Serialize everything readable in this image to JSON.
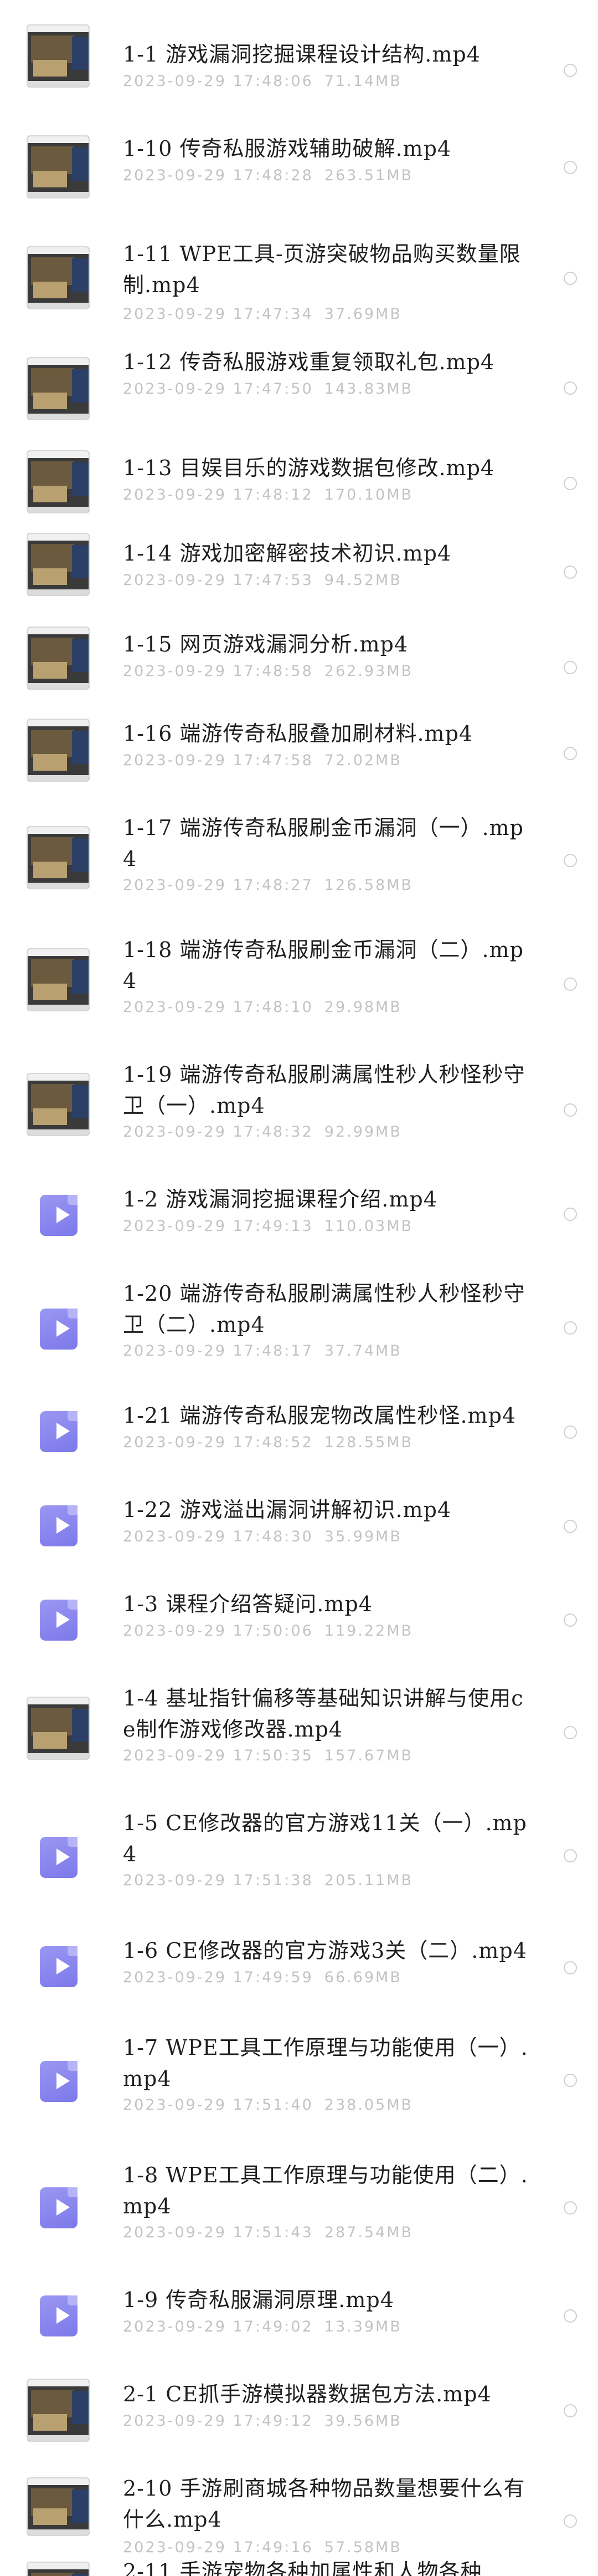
{
  "files": [
    {
      "name": "1-1 游戏漏洞挖掘课程设计结构.mp4",
      "date": "2023-09-29 17:48:06",
      "size": "71.14MB",
      "thumb": "video-thumbnail"
    },
    {
      "name": "1-10 传奇私服游戏辅助破解.mp4",
      "date": "2023-09-29 17:48:28",
      "size": "263.51MB",
      "thumb": "video-thumbnail"
    },
    {
      "name": "1-11 WPE工具-页游突破物品购买数量限制.mp4",
      "date": "2023-09-29 17:47:34",
      "size": "37.69MB",
      "thumb": "video-thumbnail"
    },
    {
      "name": "1-12 传奇私服游戏重复领取礼包.mp4",
      "date": "2023-09-29 17:47:50",
      "size": "143.83MB",
      "thumb": "video-thumbnail"
    },
    {
      "name": "1-13 目娱目乐的游戏数据包修改.mp4",
      "date": "2023-09-29 17:48:12",
      "size": "170.10MB",
      "thumb": "video-thumbnail"
    },
    {
      "name": "1-14 游戏加密解密技术初识.mp4",
      "date": "2023-09-29 17:47:53",
      "size": "94.52MB",
      "thumb": "video-thumbnail"
    },
    {
      "name": "1-15 网页游戏漏洞分析.mp4",
      "date": "2023-09-29 17:48:58",
      "size": "262.93MB",
      "thumb": "video-thumbnail"
    },
    {
      "name": "1-16 端游传奇私服叠加刷材料.mp4",
      "date": "2023-09-29 17:47:58",
      "size": "72.02MB",
      "thumb": "video-thumbnail"
    },
    {
      "name": "1-17 端游传奇私服刷金币漏洞（一）.mp4",
      "date": "2023-09-29 17:48:27",
      "size": "126.58MB",
      "thumb": "video-thumbnail"
    },
    {
      "name": "1-18 端游传奇私服刷金币漏洞（二）.mp4",
      "date": "2023-09-29 17:48:10",
      "size": "29.98MB",
      "thumb": "video-thumbnail"
    },
    {
      "name": "1-19 端游传奇私服刷满属性秒人秒怪秒守卫（一）.mp4",
      "date": "2023-09-29 17:48:32",
      "size": "92.99MB",
      "thumb": "video-thumbnail"
    },
    {
      "name": "1-2 游戏漏洞挖掘课程介绍.mp4",
      "date": "2023-09-29 17:49:13",
      "size": "110.03MB",
      "thumb": "video-file-icon"
    },
    {
      "name": "1-20 端游传奇私服刷满属性秒人秒怪秒守卫（二）.mp4",
      "date": "2023-09-29 17:48:17",
      "size": "37.74MB",
      "thumb": "video-file-icon"
    },
    {
      "name": "1-21 端游传奇私服宠物改属性秒怪.mp4",
      "date": "2023-09-29 17:48:52",
      "size": "128.55MB",
      "thumb": "video-file-icon"
    },
    {
      "name": "1-22 游戏溢出漏洞讲解初识.mp4",
      "date": "2023-09-29 17:48:30",
      "size": "35.99MB",
      "thumb": "video-file-icon"
    },
    {
      "name": "1-3 课程介绍答疑问.mp4",
      "date": "2023-09-29 17:50:06",
      "size": "119.22MB",
      "thumb": "video-file-icon"
    },
    {
      "name": "1-4 基址指针偏移等基础知识讲解与使用ce制作游戏修改器.mp4",
      "date": "2023-09-29 17:50:35",
      "size": "157.67MB",
      "thumb": "video-thumbnail"
    },
    {
      "name": "1-5 CE修改器的官方游戏11关（一）.mp4",
      "date": "2023-09-29 17:51:38",
      "size": "205.11MB",
      "thumb": "video-file-icon"
    },
    {
      "name": "1-6 CE修改器的官方游戏3关（二）.mp4",
      "date": "2023-09-29 17:49:59",
      "size": "66.69MB",
      "thumb": "video-file-icon"
    },
    {
      "name": "1-7 WPE工具工作原理与功能使用（一）.mp4",
      "date": "2023-09-29 17:51:40",
      "size": "238.05MB",
      "thumb": "video-file-icon"
    },
    {
      "name": "1-8 WPE工具工作原理与功能使用（二）.mp4",
      "date": "2023-09-29 17:51:43",
      "size": "287.54MB",
      "thumb": "video-file-icon"
    },
    {
      "name": "1-9 传奇私服漏洞原理.mp4",
      "date": "2023-09-29 17:49:02",
      "size": "13.39MB",
      "thumb": "video-file-icon"
    },
    {
      "name": "2-1 CE抓手游模拟器数据包方法.mp4",
      "date": "2023-09-29 17:49:12",
      "size": "39.56MB",
      "thumb": "video-thumbnail"
    },
    {
      "name": "2-10 手游刷商城各种物品数量想要什么有什么.mp4",
      "date": "2023-09-29 17:49:16",
      "size": "57.58MB",
      "thumb": "video-thumbnail"
    },
    {
      "name": "2-11 手游宠物各种加属性和人物各种",
      "date": "",
      "size": "",
      "thumb": "video-thumbnail"
    }
  ]
}
